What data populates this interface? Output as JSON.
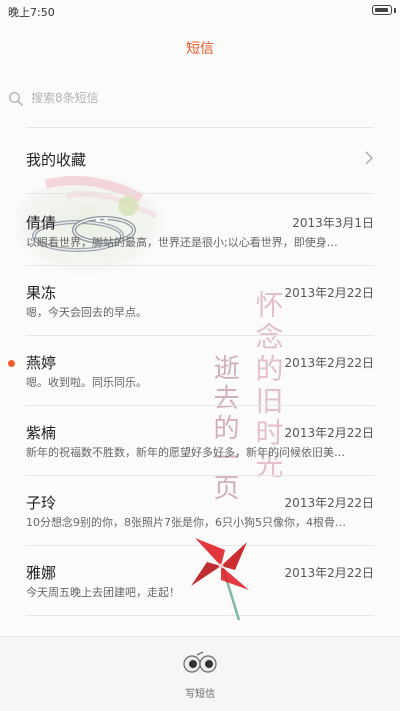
{
  "status_bar": {
    "time": "晚上7:50",
    "battery_level": 0.9
  },
  "header": {
    "title": "短信"
  },
  "search": {
    "placeholder": "搜索8条短信"
  },
  "favorites": {
    "label": "我的收藏"
  },
  "messages": [
    {
      "name": "倩倩",
      "date": "2013年3月1日",
      "preview": "以眼看世界，脚站的最高，世界还是很小;以心看世界，即使身…",
      "unread": false
    },
    {
      "name": "果冻",
      "date": "2013年2月22日",
      "preview": "嗯，今天会回去的早点。",
      "unread": false
    },
    {
      "name": "燕婷",
      "date": "2013年2月22日",
      "preview": "嗯。收到啦。同乐同乐。",
      "unread": true
    },
    {
      "name": "紫楠",
      "date": "2013年2月22日",
      "preview": "新年的祝福数不胜数，新年的愿望好多好多，新年的问候依旧美…",
      "unread": false
    },
    {
      "name": "子玲",
      "date": "2013年2月22日",
      "preview": "10分想念9别的你，8张照片7张是你，6只小狗5只像你，4根骨…",
      "unread": false
    },
    {
      "name": "雅娜",
      "date": "2013年2月22日",
      "preview": "今天周五晚上去团建吧，走起！",
      "unread": false
    }
  ],
  "decoration": {
    "calligraphy_line1": "怀念的旧时光",
    "calligraphy_line2": "逝去的一页"
  },
  "bottom_bar": {
    "compose_label": "写短信"
  },
  "colors": {
    "accent": "#e8582b",
    "unread_dot": "#f06026",
    "pinwheel": "#e0262c"
  },
  "icons": {
    "search": "search-icon",
    "favorites_arrow": "chevron-right-icon",
    "compose": "compose-icon",
    "battery": "battery-icon"
  }
}
